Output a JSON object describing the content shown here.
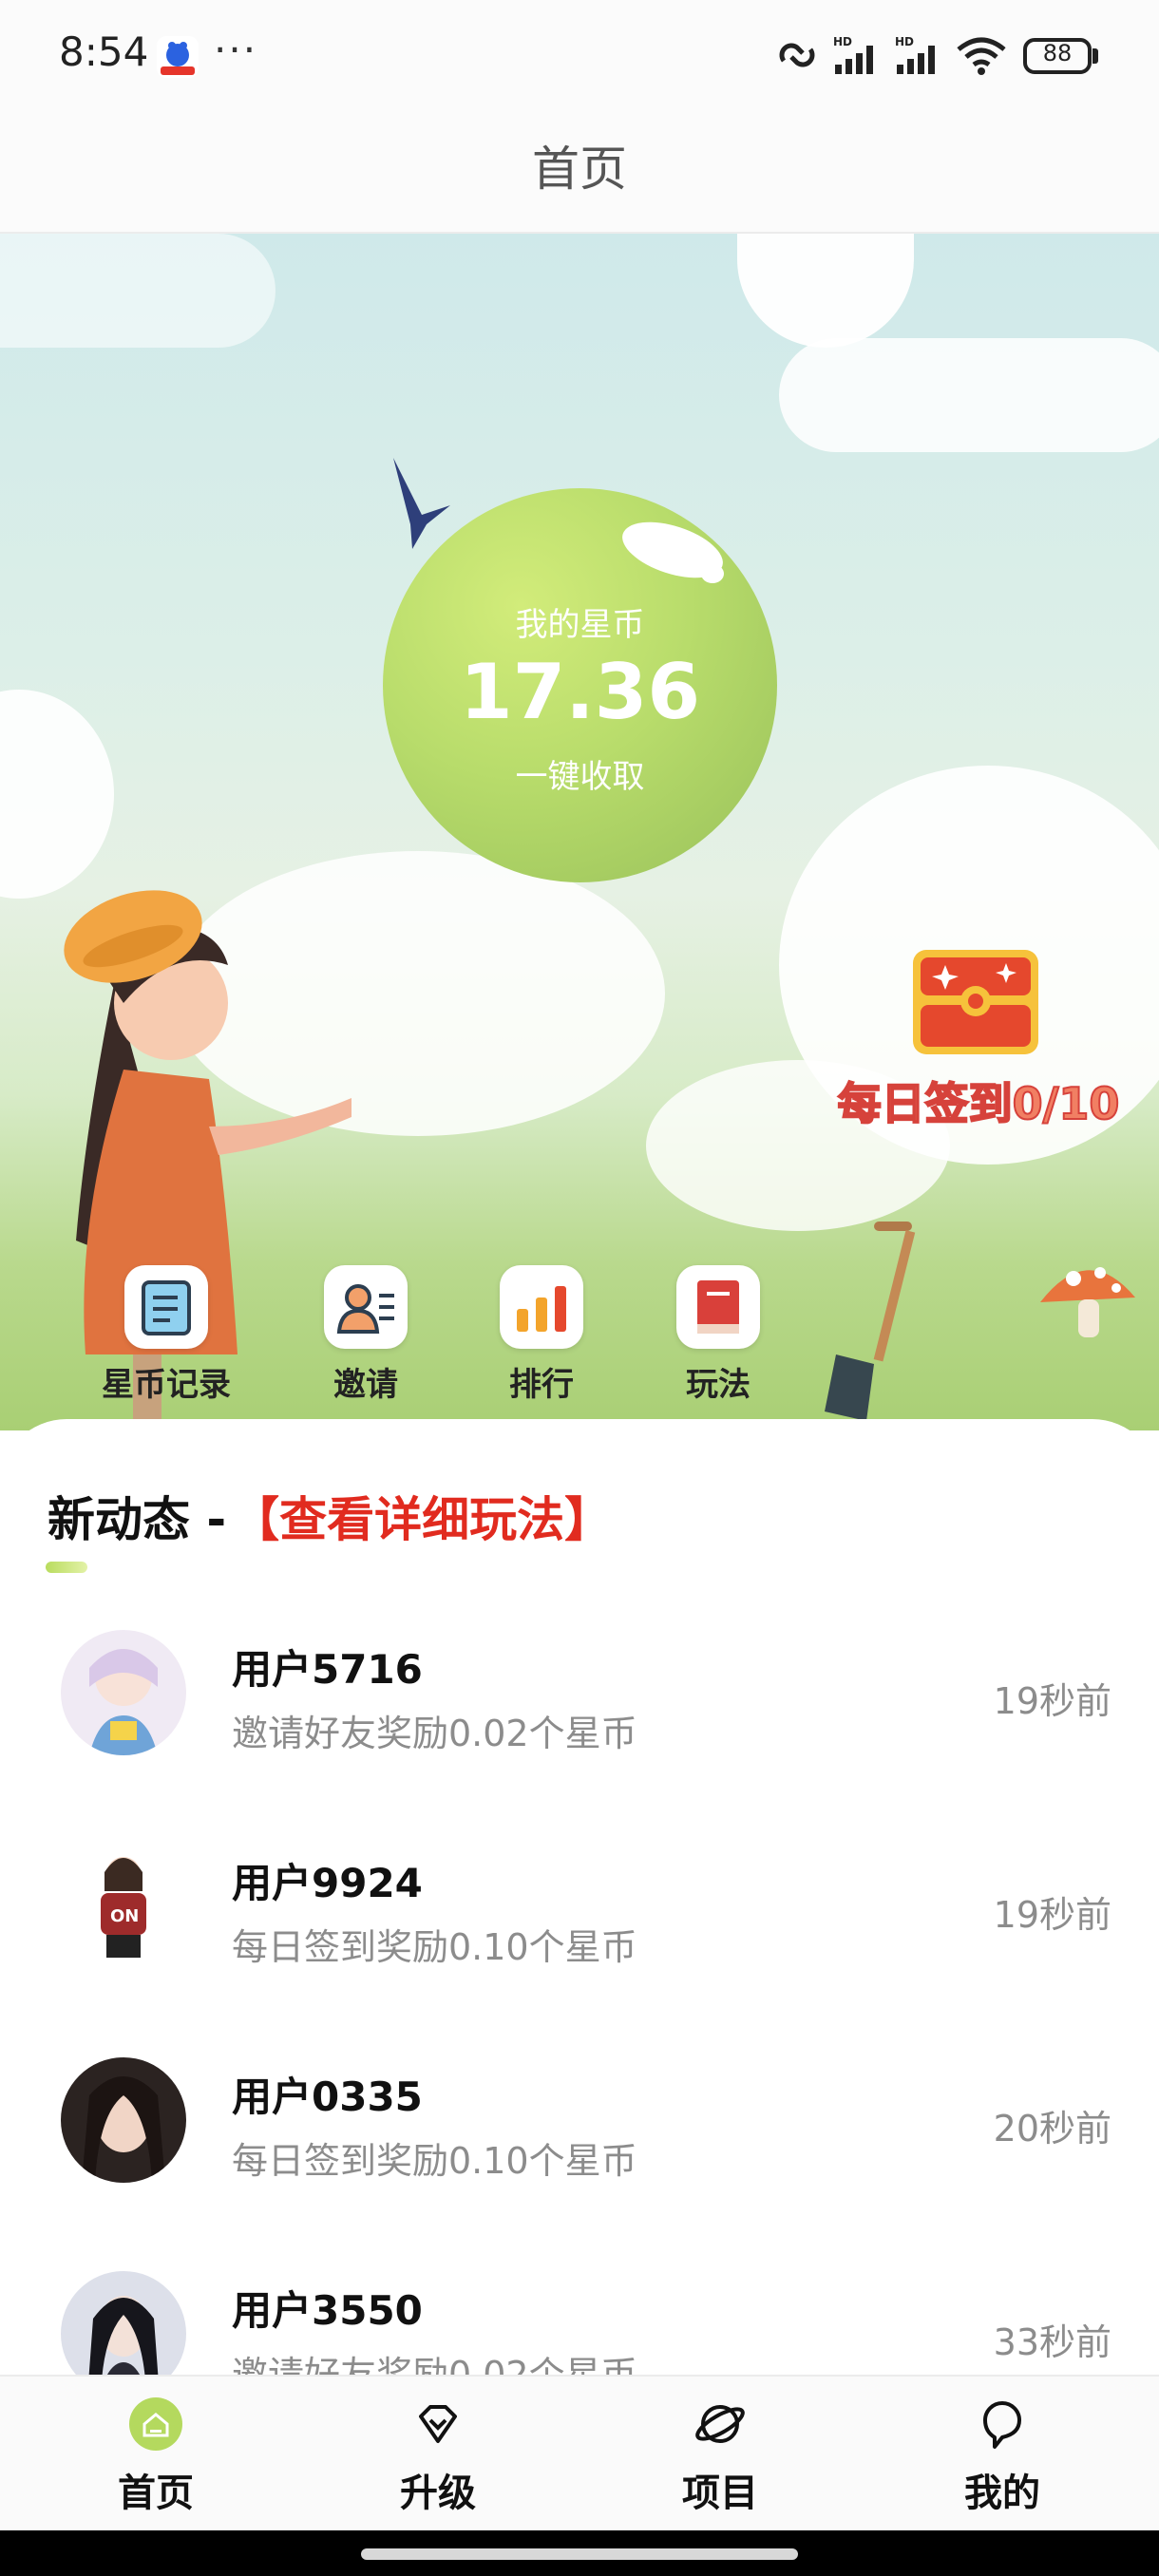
{
  "status_bar": {
    "time": "8:54",
    "more": "···",
    "battery": "88"
  },
  "header": {
    "title": "首页"
  },
  "hero": {
    "coin_label": "我的星币",
    "coin_value": "17.36",
    "collect_label": "一键收取",
    "checkin_label": "每日签到0/10",
    "shortcuts": [
      {
        "label": "星币记录",
        "icon": "record-icon"
      },
      {
        "label": "邀请",
        "icon": "invite-icon"
      },
      {
        "label": "排行",
        "icon": "rank-icon"
      },
      {
        "label": "玩法",
        "icon": "guide-book-icon"
      }
    ]
  },
  "feed": {
    "title": "新动态 -",
    "link": "【查看详细玩法】",
    "items": [
      {
        "user": "用户5716",
        "action": "邀请好友奖励0.02个星币",
        "time": "19秒前"
      },
      {
        "user": "用户9924",
        "action": "每日签到奖励0.10个星币",
        "time": "19秒前"
      },
      {
        "user": "用户0335",
        "action": "每日签到奖励0.10个星币",
        "time": "20秒前"
      },
      {
        "user": "用户3550",
        "action": "邀请好友奖励0.02个星币",
        "time": "33秒前"
      }
    ]
  },
  "tabbar": {
    "items": [
      {
        "label": "首页",
        "icon": "home-icon",
        "active": true
      },
      {
        "label": "升级",
        "icon": "diamond-icon",
        "active": false
      },
      {
        "label": "项目",
        "icon": "planet-icon",
        "active": false
      },
      {
        "label": "我的",
        "icon": "profile-icon",
        "active": false
      }
    ]
  },
  "colors": {
    "accent_green": "#b8dc6b",
    "link_red": "#e12b1f",
    "checkin_red": "#f17f63"
  }
}
